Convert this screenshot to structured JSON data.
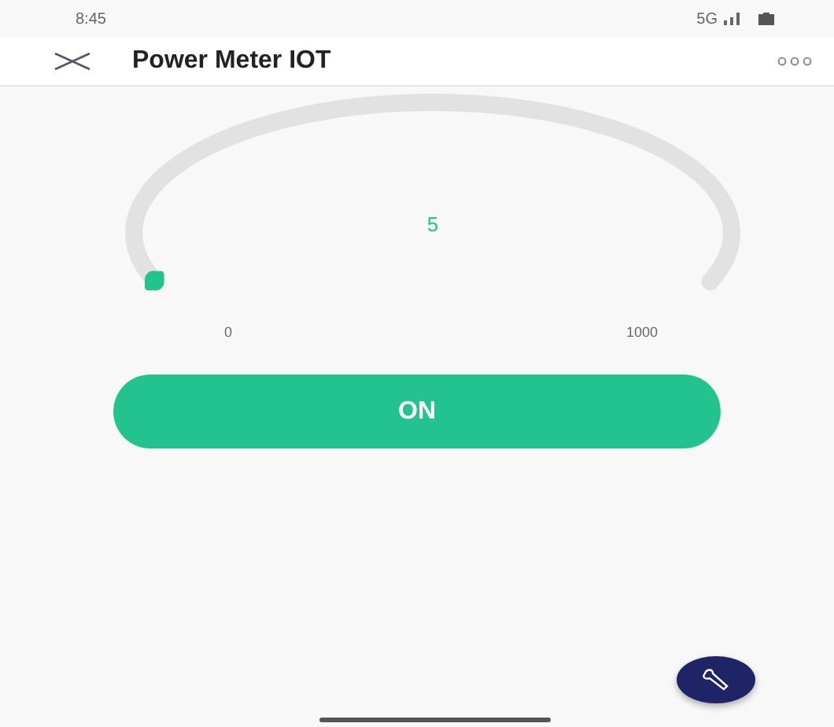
{
  "status_bar": {
    "time": "8:45",
    "network": "5G"
  },
  "app_bar": {
    "title": "Power Meter IOT"
  },
  "gauge": {
    "value": "5",
    "min_label": "0",
    "max_label": "1000",
    "level": 0.005
  },
  "power_button": {
    "label": "ON",
    "on": true
  }
}
